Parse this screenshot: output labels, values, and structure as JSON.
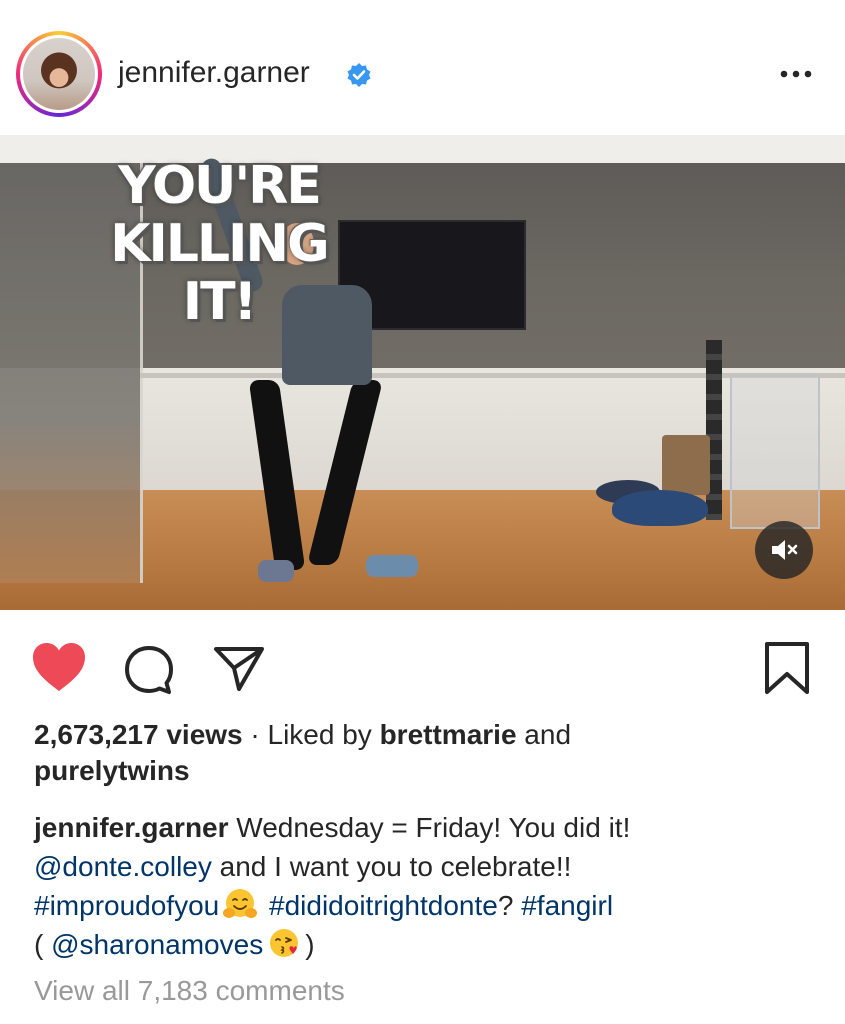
{
  "post": {
    "username": "jennifer.garner",
    "verified": true,
    "menu_icon": "more-horizontal-icon"
  },
  "video": {
    "overlay_lines": [
      "YOU'RE",
      "KILLING",
      "IT!"
    ],
    "mute_icon": "speaker-muted-icon"
  },
  "actions": {
    "like_icon": "heart-filled-icon",
    "comment_icon": "comment-bubble-icon",
    "share_icon": "paper-plane-icon",
    "save_icon": "bookmark-icon",
    "like_color": "#ed4956"
  },
  "stats": {
    "views": "2,673,217 views",
    "separator": " · Liked by ",
    "liked_by_1": "brettmarie",
    "and": " and",
    "liked_by_2": "purelytwins"
  },
  "caption": {
    "author": "jennifer.garner",
    "text_1": " Wednesday = Friday! You did it!",
    "mention_1": "@donte.colley",
    "text_2": " and I want you to celebrate!!",
    "hashtag_1": "#improudofyou",
    "hashtag_2": "#dididoitrightdonte",
    "text_3": "? ",
    "hashtag_3": "#fangirl",
    "open_paren": "( ",
    "mention_2": "@sharonamoves",
    "close_paren": ")",
    "emoji_1": "hugging-face-emoji",
    "emoji_2": "face-blowing-kiss-emoji"
  },
  "comments": {
    "view_all": "View all 7,183 comments"
  },
  "colors": {
    "link": "#003569",
    "muted": "#999999",
    "verified": "#3897f0"
  }
}
